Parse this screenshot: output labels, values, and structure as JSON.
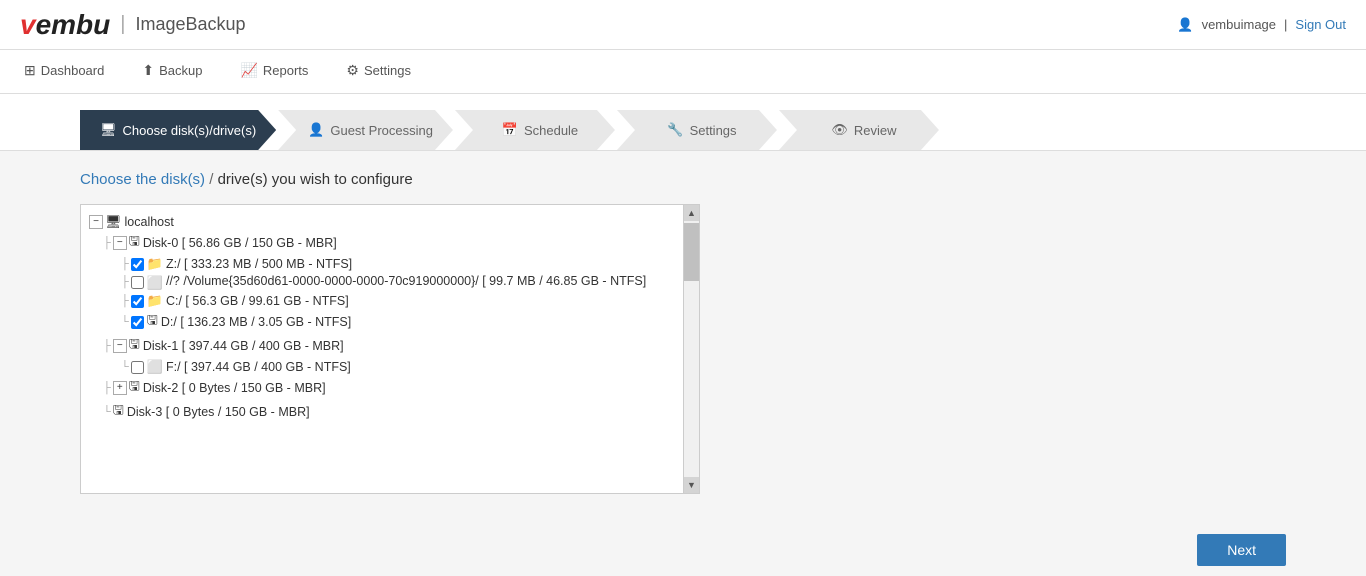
{
  "header": {
    "logo_brand": "vembu",
    "logo_brand_highlight": "v",
    "logo_separator": "|",
    "logo_product": "ImageBackup",
    "user_name": "vembuimage",
    "sign_out_label": "Sign Out"
  },
  "nav": {
    "items": [
      {
        "id": "dashboard",
        "label": "Dashboard",
        "icon": "⊞"
      },
      {
        "id": "backup",
        "label": "Backup",
        "icon": "⬆"
      },
      {
        "id": "reports",
        "label": "Reports",
        "icon": "📈"
      },
      {
        "id": "settings",
        "label": "Settings",
        "icon": "⚙"
      }
    ]
  },
  "steps": [
    {
      "id": "choose-disks",
      "label": "Choose disk(s)/drive(s)",
      "icon": "🖥",
      "active": true
    },
    {
      "id": "guest-processing",
      "label": "Guest Processing",
      "icon": "👤",
      "active": false
    },
    {
      "id": "schedule",
      "label": "Schedule",
      "icon": "📅",
      "active": false
    },
    {
      "id": "settings",
      "label": "Settings",
      "icon": "🔧",
      "active": false
    },
    {
      "id": "review",
      "label": "Review",
      "icon": "👁",
      "active": false
    }
  ],
  "page": {
    "title_part1": "Choose the disk(s)",
    "title_separator": " / ",
    "title_part2": "drive(s) you wish to configure"
  },
  "tree": {
    "root": {
      "label": "localhost",
      "icon": "🖥",
      "children": [
        {
          "label": "Disk-0 [ 56.86 GB / 150 GB - MBR]",
          "icon": "💾",
          "children": [
            {
              "label": "Z:/ [ 333.23 MB / 500 MB - NTFS]",
              "icon": "📁",
              "checked": true
            },
            {
              "label": "//? /Volume{35d60d61-0000-0000-0000-70c919000000}/ [ 99.7 MB / 46.85 GB - NTFS]",
              "icon": "⬜",
              "checked": false,
              "multiline": true
            },
            {
              "label": "C:/ [ 56.3 GB / 99.61 GB - NTFS]",
              "icon": "📁",
              "checked": true
            },
            {
              "label": "D:/ [ 136.23 MB / 3.05 GB - NTFS]",
              "icon": "💾",
              "checked": true
            }
          ]
        },
        {
          "label": "Disk-1 [ 397.44 GB / 400 GB - MBR]",
          "icon": "💾",
          "children": [
            {
              "label": "F:/ [ 397.44 GB / 400 GB - NTFS]",
              "icon": "⬜",
              "checked": false
            }
          ]
        },
        {
          "label": "Disk-2 [ 0 Bytes / 150 GB - MBR]",
          "icon": "💾",
          "children": []
        },
        {
          "label": "Disk-3 [ 0 Bytes / 150 GB - MBR]",
          "icon": "💾",
          "children": []
        }
      ]
    }
  },
  "footer": {
    "next_button_label": "Next"
  }
}
